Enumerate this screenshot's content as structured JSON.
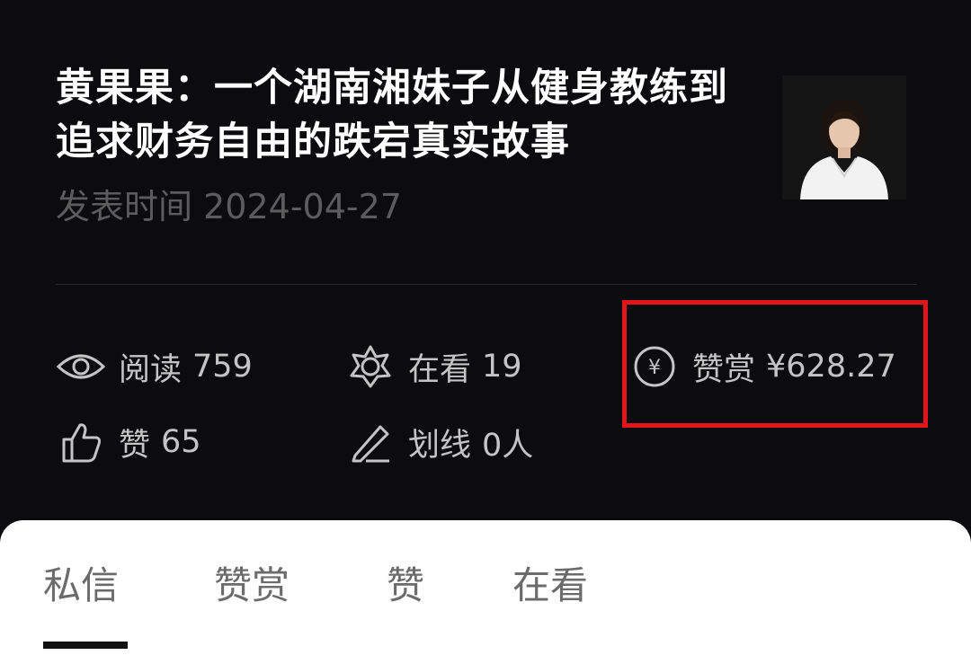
{
  "article": {
    "title": "黄果果：一个湖南湘妹子从健身教练到追求财务自由的跌宕真实故事",
    "date_label": "发表时间",
    "date": "2024-04-27"
  },
  "stats": {
    "reads": {
      "label": "阅读",
      "value": "759",
      "icon": "eye-icon"
    },
    "watching": {
      "label": "在看",
      "value": "19",
      "icon": "sparkle-icon"
    },
    "reward": {
      "label": "赞赏",
      "value": "¥628.27",
      "icon": "yuan-circle-icon"
    },
    "likes": {
      "label": "赞",
      "value": "65",
      "icon": "thumbs-up-icon"
    },
    "underline": {
      "label": "划线",
      "value": "0人",
      "icon": "pen-icon"
    }
  },
  "tabs": [
    {
      "label": "私信",
      "active": true
    },
    {
      "label": "赞赏",
      "active": false
    },
    {
      "label": "赞",
      "active": false
    },
    {
      "label": "在看",
      "active": false
    }
  ],
  "colors": {
    "background": "#0c0c0e",
    "highlight_border": "#e3141b",
    "sheet": "#ffffff"
  }
}
